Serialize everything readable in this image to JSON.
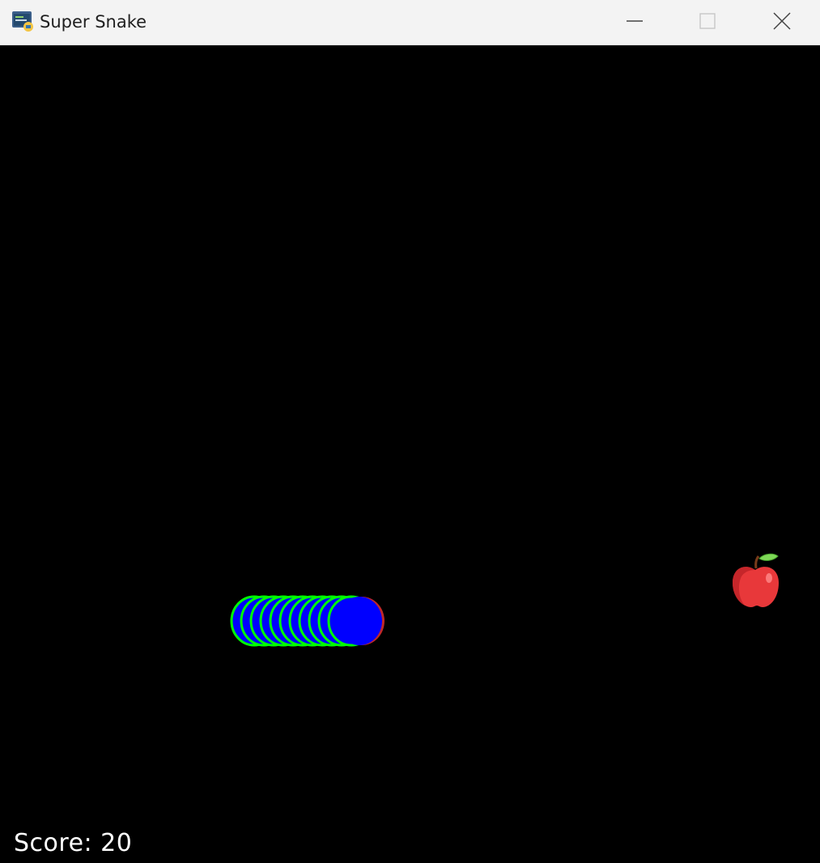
{
  "window": {
    "title": "Super Snake",
    "icon": "python-icon",
    "controls": {
      "minimize_icon": "minimize-icon",
      "maximize_icon": "maximize-icon",
      "close_icon": "close-icon"
    }
  },
  "game": {
    "background_color": "#000000",
    "score_label": "Score:",
    "score_value": "20",
    "score_text": "Score: 20",
    "snake": {
      "direction": "right",
      "head_color": "#0000ff",
      "body_color": "#00ff00",
      "body_stripe_color": "#0000ff",
      "head_edge_color": "#c0282a"
    },
    "food": {
      "type": "apple",
      "icon": "apple-icon",
      "color": "#e8383a",
      "leaf_color": "#7ed957"
    }
  }
}
